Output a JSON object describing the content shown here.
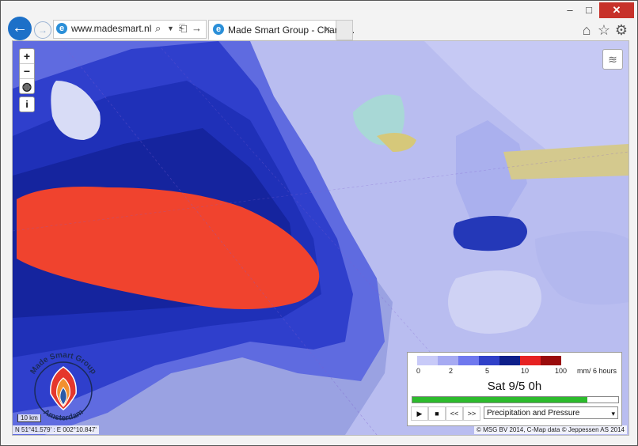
{
  "browser": {
    "window_controls": {
      "minimize": "–",
      "maximize": "□",
      "close": "✕"
    },
    "nav": {
      "back_icon": "back-arrow-icon",
      "forward_icon": "forward-arrow-icon"
    },
    "address_bar": {
      "url": "www.madesmart.nl",
      "icon": "ie-icon",
      "search_icon": "search-icon",
      "dropdown_icon": "chevron-down-icon",
      "compat_icon": "compat-icon",
      "go_icon": "go-arrow-icon"
    },
    "tab": {
      "title": "Made Smart Group - ChartS...",
      "close": "×",
      "icon": "ie-icon"
    },
    "tools": {
      "home_icon": "home-icon",
      "favorites_icon": "star-icon",
      "settings_icon": "gear-icon"
    }
  },
  "map": {
    "controls": {
      "zoom_in": "+",
      "zoom_out": "−",
      "globe_icon": "globe-icon",
      "info": "i",
      "layers_icon": "layers-icon"
    },
    "scale": "10 km",
    "coords": "N 51°41.579' : E 002°10.847'",
    "attribution": "© MSG BV 2014, C-Map data © Jeppessen AS 2014"
  },
  "legend": {
    "ticks": [
      "0",
      "2",
      "5",
      "10",
      "100"
    ],
    "unit": "mm/ 6 hours",
    "colors": [
      "#c8caf8",
      "#a6aaf2",
      "#6f78ee",
      "#3040c8",
      "#0e1f8a",
      "#e62222",
      "#9a0c0c"
    ],
    "time": "Sat 9/5 0h",
    "progress": 0.85,
    "buttons": {
      "play": "▶",
      "stop": "■",
      "prev": "<<",
      "next": ">>"
    },
    "layer_select": "Precipitation and Pressure",
    "select_arrow": "▾"
  },
  "logo": {
    "top_text": "Made Smart Group",
    "bottom_text": "Amsterdam",
    "colors": {
      "red": "#e5372c",
      "orange": "#f2902f",
      "blue": "#2a5aa8"
    }
  }
}
